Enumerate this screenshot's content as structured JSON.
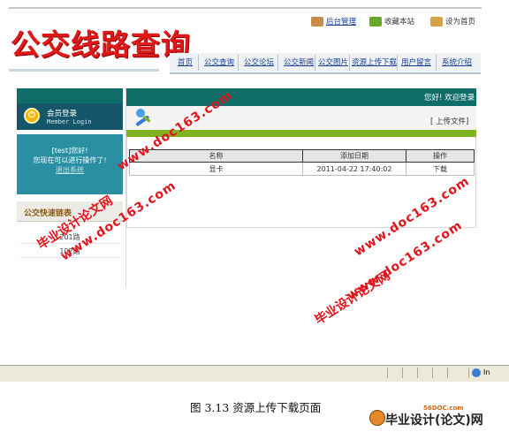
{
  "header": {
    "logo_title": "公交线路查询",
    "top_links": [
      "后台管理",
      "收藏本站",
      "设为首页"
    ],
    "nav": [
      "首页",
      "公交查询",
      "公交论坛",
      "公交新闻",
      "公交图片",
      "资源上传下载",
      "用户留言",
      "系统介绍"
    ]
  },
  "sidebar": {
    "login_title": "会员登录",
    "login_subtitle": "Member Login",
    "greeting": "[test]您好!",
    "prompt": "您现在可以进行操作了!",
    "exit_link": "退出系统",
    "links_title": "公交快速链表",
    "links": [
      "201路",
      "102路"
    ]
  },
  "main": {
    "welcome": "您好! 欢迎登录",
    "upload_link": "[ 上传文件]",
    "table": {
      "headers": [
        "名称",
        "添加日期",
        "操作"
      ],
      "rows": [
        {
          "name": "显卡",
          "date": "2011-04-22 17:40:02",
          "action": "下载"
        }
      ]
    }
  },
  "watermarks": {
    "cn": "毕业设计论文网",
    "url": "www.doc163.com"
  },
  "status_bar": {
    "zone": "In"
  },
  "caption": "图 3.13 资源上传下载页面",
  "brand": {
    "url": "56DOC.com",
    "name": "毕业设计(论文)网"
  },
  "colors": {
    "logo_red": "#e01818",
    "teal_dark": "#0f6c66",
    "teal_panel": "#2a8fa2",
    "green_bar": "#7fb31f",
    "watermark_red": "#e3141b"
  }
}
